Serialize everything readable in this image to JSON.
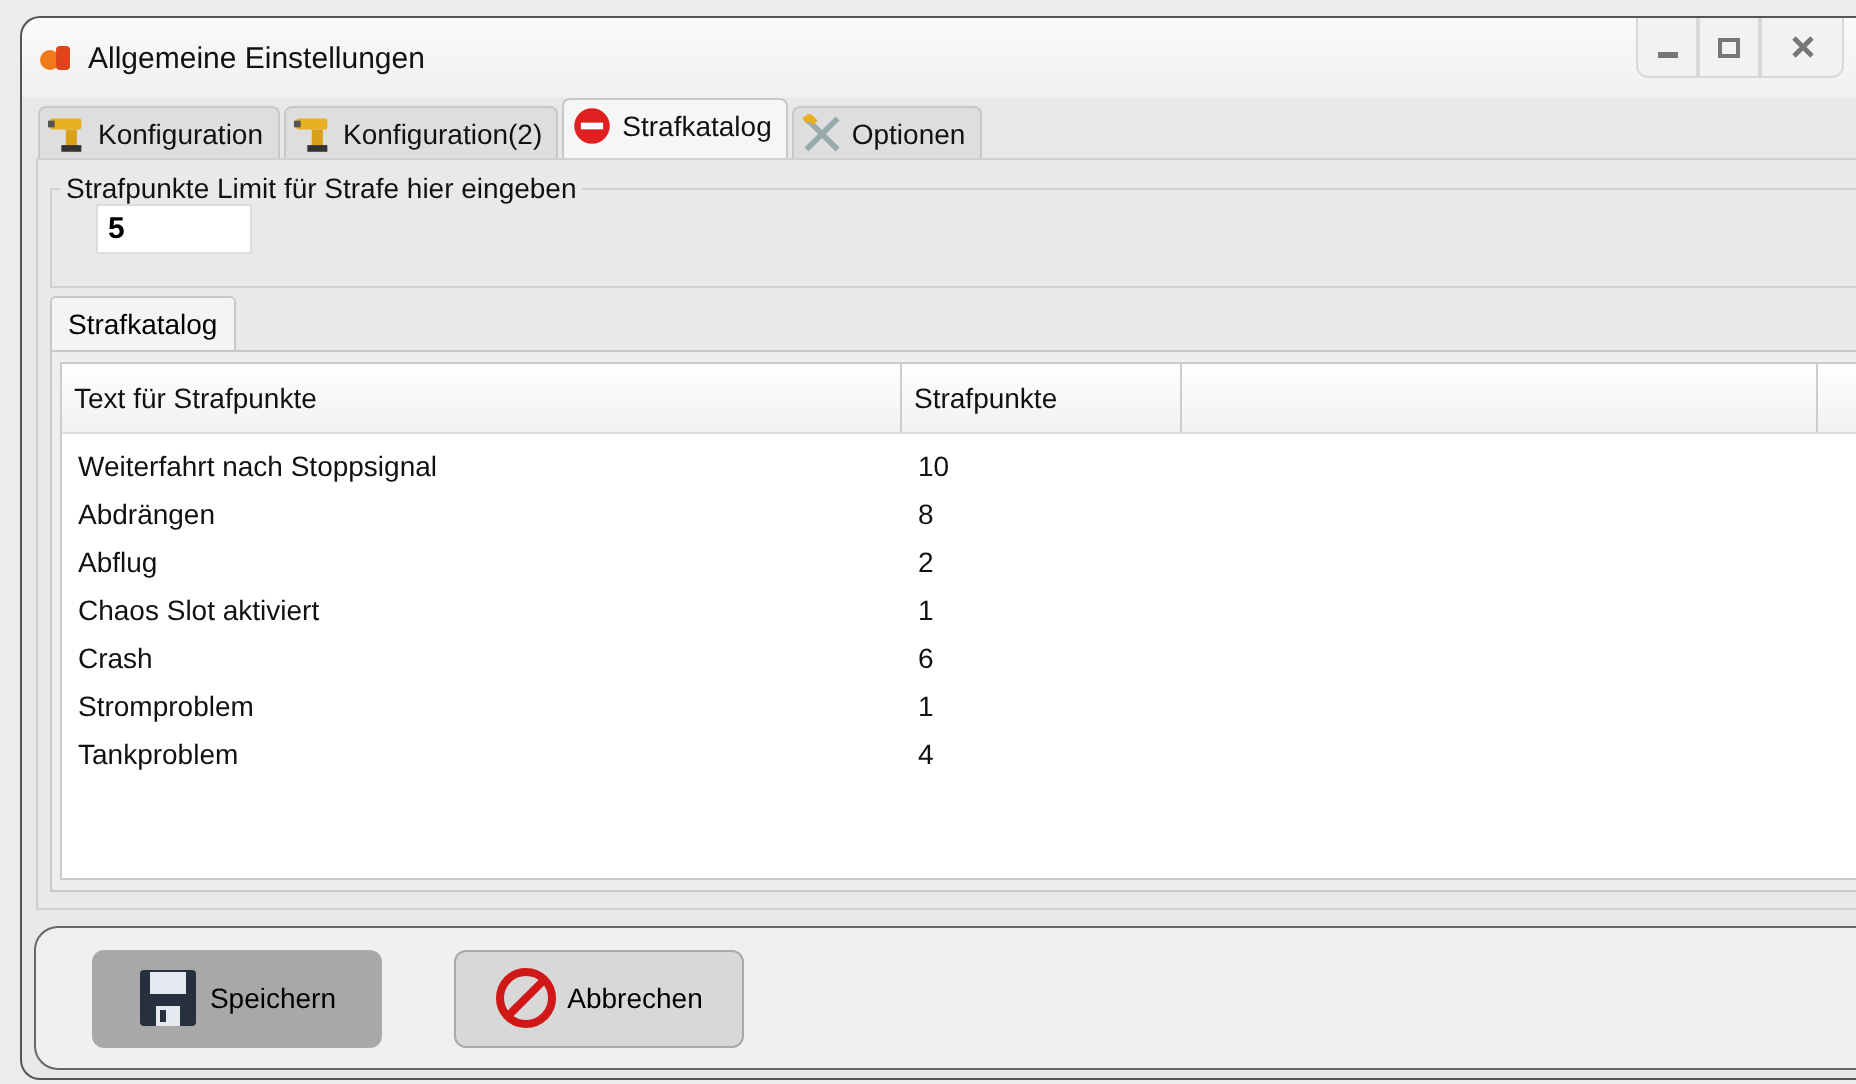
{
  "window": {
    "title": "Allgemeine Einstellungen"
  },
  "tabs": [
    {
      "label": "Konfiguration",
      "kind": "drill",
      "selected": false
    },
    {
      "label": "Konfiguration(2)",
      "kind": "drill",
      "selected": false
    },
    {
      "label": "Strafkatalog",
      "kind": "stop",
      "selected": true
    },
    {
      "label": "Optionen",
      "kind": "tools",
      "selected": false
    }
  ],
  "limit_group": {
    "legend": "Strafpunkte Limit für Strafe hier eingeben",
    "value": "5"
  },
  "inner_tabs": [
    {
      "label": "Strafkatalog",
      "selected": true
    }
  ],
  "table": {
    "columns": [
      "Text für Strafpunkte",
      "Strafpunkte"
    ],
    "rows": [
      [
        "Weiterfahrt nach Stoppsignal",
        "10"
      ],
      [
        "Abdrängen",
        "8"
      ],
      [
        "Abflug",
        "2"
      ],
      [
        "Chaos Slot aktiviert",
        "1"
      ],
      [
        "Crash",
        "6"
      ],
      [
        "Stromproblem",
        "1"
      ],
      [
        "Tankproblem",
        "4"
      ]
    ]
  },
  "buttons": [
    {
      "label": "Speichern",
      "kind": "save",
      "selected": true
    },
    {
      "label": "Abbrechen",
      "kind": "cancel",
      "selected": false
    }
  ]
}
